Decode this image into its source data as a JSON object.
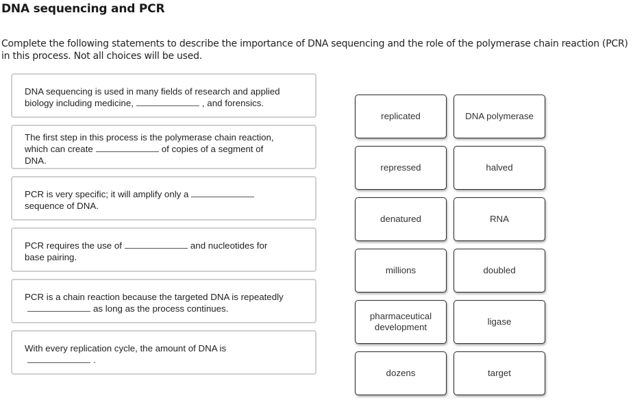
{
  "page": {
    "title": "DNA sequencing and PCR",
    "instructions": "Complete the following statements to describe the importance of DNA sequencing and the role of the polymerase chain reaction (PCR) in this process. Not all choices will be used."
  },
  "statements": [
    {
      "before": "DNA sequencing is used in many fields of research and applied biology including medicine,",
      "after": ", and forensics.",
      "blank_value": ""
    },
    {
      "before": "The first step in this process is the polymerase chain reaction, which can create",
      "after": "of copies of a segment of DNA.",
      "blank_value": ""
    },
    {
      "before": "PCR is very specific; it will amplify only a",
      "after": "sequence of DNA.",
      "blank_value": ""
    },
    {
      "before": "PCR requires the use of",
      "after": "and nucleotides for base pairing.",
      "blank_value": ""
    },
    {
      "before": "PCR is a chain reaction because the targeted DNA is repeatedly",
      "after": "as long as the process continues.",
      "blank_value": ""
    },
    {
      "before": "With every replication cycle, the amount of DNA is",
      "after": ".",
      "blank_value": ""
    }
  ],
  "choices": [
    {
      "label": "replicated"
    },
    {
      "label": "DNA polymerase"
    },
    {
      "label": "repressed"
    },
    {
      "label": "halved"
    },
    {
      "label": "denatured"
    },
    {
      "label": "RNA"
    },
    {
      "label": "millions"
    },
    {
      "label": "doubled"
    },
    {
      "label": "pharmaceutical development"
    },
    {
      "label": "ligase"
    },
    {
      "label": "dozens"
    },
    {
      "label": "target"
    }
  ]
}
